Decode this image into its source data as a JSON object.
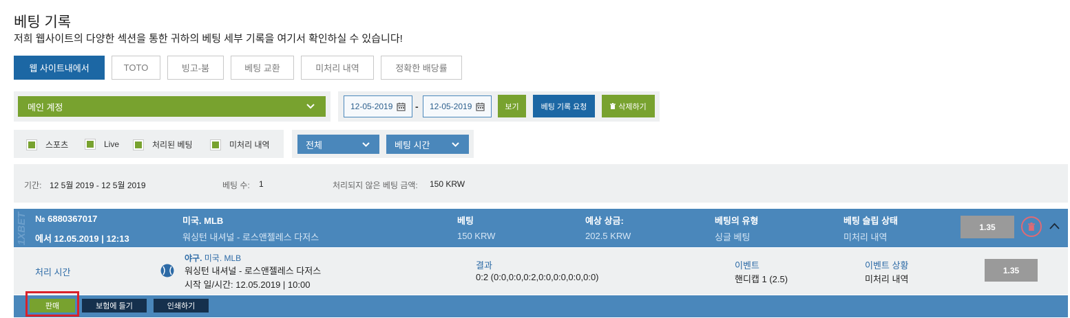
{
  "header": {
    "title": "베팅 기록",
    "subtitle": "저희 웹사이트의 다양한 섹션을 통한 귀하의 베팅 세부 기록을 여기서 확인하실 수 있습니다!"
  },
  "tabs": [
    {
      "label": "웹 사이트내에서",
      "active": true
    },
    {
      "label": "TOTO",
      "active": false
    },
    {
      "label": "빙고-붐",
      "active": false
    },
    {
      "label": "베팅 교환",
      "active": false
    },
    {
      "label": "미처리 내역",
      "active": false
    },
    {
      "label": "정확한 배당률",
      "active": false
    }
  ],
  "filters": {
    "account": "메인 계정",
    "date_from": "12-05-2019",
    "date_to": "12-05-2019",
    "date_separator": "-",
    "view_button": "보기",
    "request_button": "베팅 기록 요청",
    "delete_button": "삭제하기",
    "checkboxes": [
      "스포츠",
      "Live",
      "처리된 베팅",
      "미처리 내역"
    ],
    "type_dropdown": "전체",
    "time_dropdown": "베팅 시간"
  },
  "summary": {
    "period_label": "기간:",
    "period_value": "12 5월 2019 - 12 5월 2019",
    "count_label": "베팅 수:",
    "count_value": "1",
    "unsettled_label": "처리되지 않은 베팅 금액:",
    "unsettled_value": "150 KRW"
  },
  "bet": {
    "watermark": "1XBET",
    "id": "№ 6880367017",
    "datetime": "에서 12.05.2019 | 12:13",
    "league": "미국. MLB",
    "match": "워싱턴 내셔널 - 로스앤젤레스 다저스",
    "stake_label": "베팅",
    "stake_value": "150 KRW",
    "winnings_label": "예상 상금:",
    "winnings_value": "202.5 KRW",
    "type_label": "베팅의 유형",
    "type_value": "싱글 베팅",
    "status_label": "베팅 슬립 상태",
    "status_value": "미처리 내역",
    "odds": "1.35"
  },
  "detail": {
    "settle_time_label": "처리 시간",
    "sport": "야구.",
    "league": "미국. MLB",
    "match": "워싱턴 내셔널 - 로스앤젤레스 다저스",
    "start": "시작 일/시간: 12.05.2019 | 10:00",
    "result_label": "결과",
    "result_value": "0:2 (0:0,0:0,0:2,0:0,0:0,0:0,0:0)",
    "event_label": "이벤트",
    "event_value": "핸디캡 1 (2.5)",
    "event_status_label": "이벤트 상황",
    "event_status_value": "미처리 내역",
    "odds": "1.35"
  },
  "actions": {
    "sell": "판매",
    "insure": "보험에 들기",
    "print": "인쇄하기"
  },
  "colors": {
    "brand_blue": "#1c67a4",
    "bet_row": "#4a87bb",
    "green": "#78a22f",
    "highlight": "#d9212a"
  }
}
